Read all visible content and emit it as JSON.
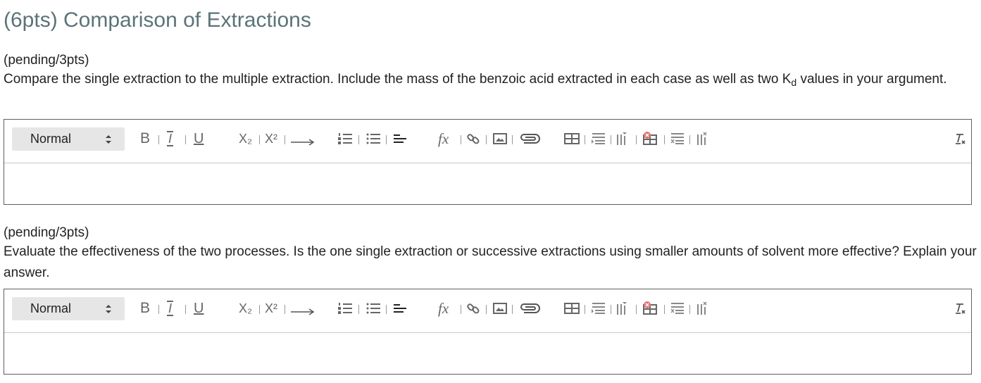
{
  "page": {
    "title": "(6pts) Comparison of Extractions"
  },
  "questions": [
    {
      "status": "(pending/3pts)",
      "prompt_before": "Compare the single extraction to the multiple extraction. Include the mass of the benzoic acid extracted in each case as well as two K",
      "prompt_sub": "d",
      "prompt_after": " values in your argument.",
      "answer": ""
    },
    {
      "status": "(pending/3pts)",
      "prompt_before": "Evaluate the effectiveness of the two processes. Is the one single extraction or successive extractions using smaller amounts of solvent more effective? Explain your answer.",
      "prompt_sub": "",
      "prompt_after": "",
      "answer": ""
    }
  ],
  "toolbar": {
    "format_select": "Normal",
    "bold": "B",
    "italic": "I",
    "underline": "U",
    "subscript": "X₂",
    "superscript": "X²",
    "formula": "fx"
  },
  "icons": [
    "bold-icon",
    "italic-icon",
    "underline-icon",
    "subscript-icon",
    "superscript-icon",
    "arrow-icon",
    "ordered-list-icon",
    "bullet-list-icon",
    "align-icon",
    "formula-icon",
    "link-icon",
    "image-icon",
    "attachment-icon",
    "table-icon",
    "insert-row-icon",
    "insert-column-icon",
    "delete-table-icon",
    "delete-row-icon",
    "delete-column-icon",
    "clear-format-icon"
  ],
  "colors": {
    "title": "#5b7378",
    "toolbar_bg": "#e6e6e6",
    "icon": "#666666",
    "border": "#5f5f5f"
  }
}
